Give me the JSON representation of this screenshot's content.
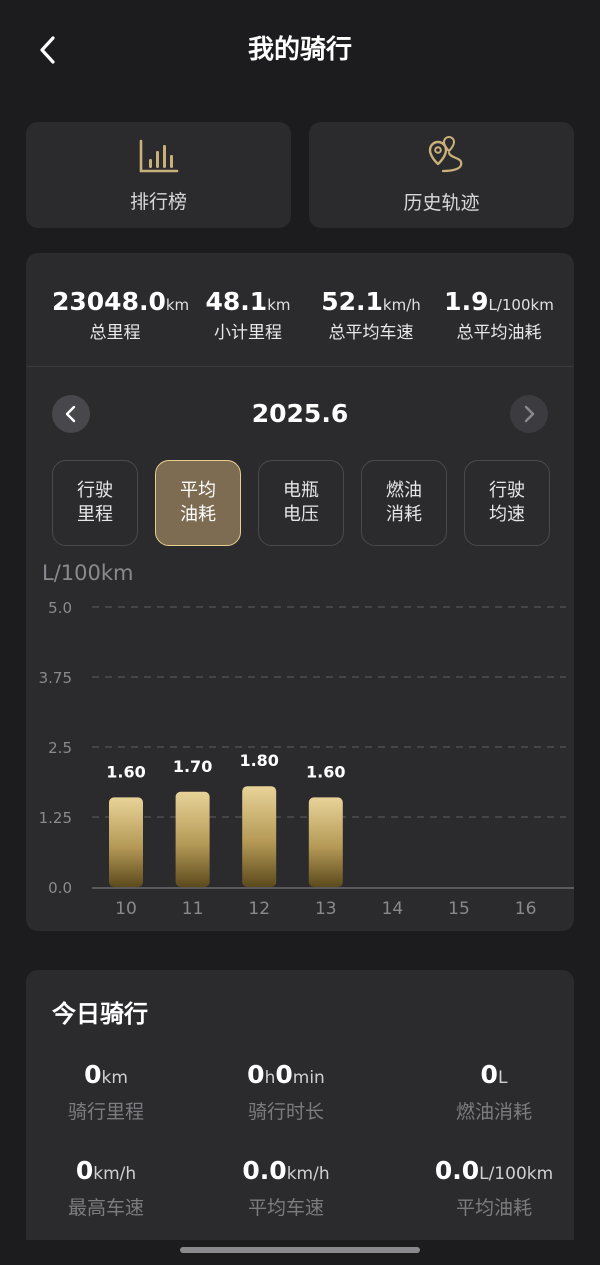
{
  "header": {
    "title": "我的骑行"
  },
  "quick_actions": [
    {
      "label": "排行榜",
      "icon": "bar-chart-icon"
    },
    {
      "label": "历史轨迹",
      "icon": "route-pin-icon"
    }
  ],
  "totals": [
    {
      "value": "23048.0",
      "unit": "km",
      "caption": "总里程"
    },
    {
      "value": "48.1",
      "unit": "km",
      "caption": "小计里程"
    },
    {
      "value": "52.1",
      "unit": "km/h",
      "caption": "总平均车速"
    },
    {
      "value": "1.9",
      "unit": "L/100km",
      "caption": "总平均油耗"
    }
  ],
  "period": {
    "label": "2025.6"
  },
  "metric_tabs": [
    {
      "label": "行驶\n里程",
      "active": false
    },
    {
      "label": "平均\n油耗",
      "active": true
    },
    {
      "label": "电瓶\n电压",
      "active": false
    },
    {
      "label": "燃油\n消耗",
      "active": false
    },
    {
      "label": "行驶\n均速",
      "active": false
    }
  ],
  "chart_unit": "L/100km",
  "chart_data": {
    "type": "bar",
    "ylabel": "L/100km",
    "ylim": [
      0,
      5
    ],
    "yticks": [
      "0.0",
      "1.25",
      "2.5",
      "3.75",
      "5.0"
    ],
    "categories": [
      "10",
      "11",
      "12",
      "13",
      "14",
      "15",
      "16"
    ],
    "values": [
      1.6,
      1.7,
      1.8,
      1.6,
      null,
      null,
      null
    ],
    "data_labels": [
      "1.60",
      "1.70",
      "1.80",
      "1.60",
      "",
      "",
      ""
    ],
    "grid": true,
    "colors": {
      "bar_top": "#e8d398",
      "bar_bottom": "#5c4a1c",
      "grid": "#555559",
      "axis_text": "#8a8a8e"
    }
  },
  "today": {
    "title": "今日骑行",
    "items": [
      {
        "parts": [
          {
            "t": "0",
            "k": "num"
          },
          {
            "t": "km",
            "k": "unit"
          }
        ],
        "caption": "骑行里程"
      },
      {
        "parts": [
          {
            "t": "0",
            "k": "num"
          },
          {
            "t": "h",
            "k": "unit"
          },
          {
            "t": "0",
            "k": "num"
          },
          {
            "t": "min",
            "k": "unit"
          }
        ],
        "caption": "骑行时长"
      },
      {
        "parts": [
          {
            "t": "0",
            "k": "num"
          },
          {
            "t": "L",
            "k": "unit"
          }
        ],
        "caption": "燃油消耗"
      },
      {
        "parts": [
          {
            "t": "0",
            "k": "num"
          },
          {
            "t": "km/h",
            "k": "unit"
          }
        ],
        "caption": "最高车速"
      },
      {
        "parts": [
          {
            "t": "0.0",
            "k": "num"
          },
          {
            "t": "km/h",
            "k": "unit"
          }
        ],
        "caption": "平均车速"
      },
      {
        "parts": [
          {
            "t": "0.0",
            "k": "num"
          },
          {
            "t": "L/100km",
            "k": "unit"
          }
        ],
        "caption": "平均油耗"
      }
    ]
  },
  "colors": {
    "background": "#1c1c1e",
    "card": "#2b2b2e",
    "accent_gold": "#e9cf8e"
  }
}
